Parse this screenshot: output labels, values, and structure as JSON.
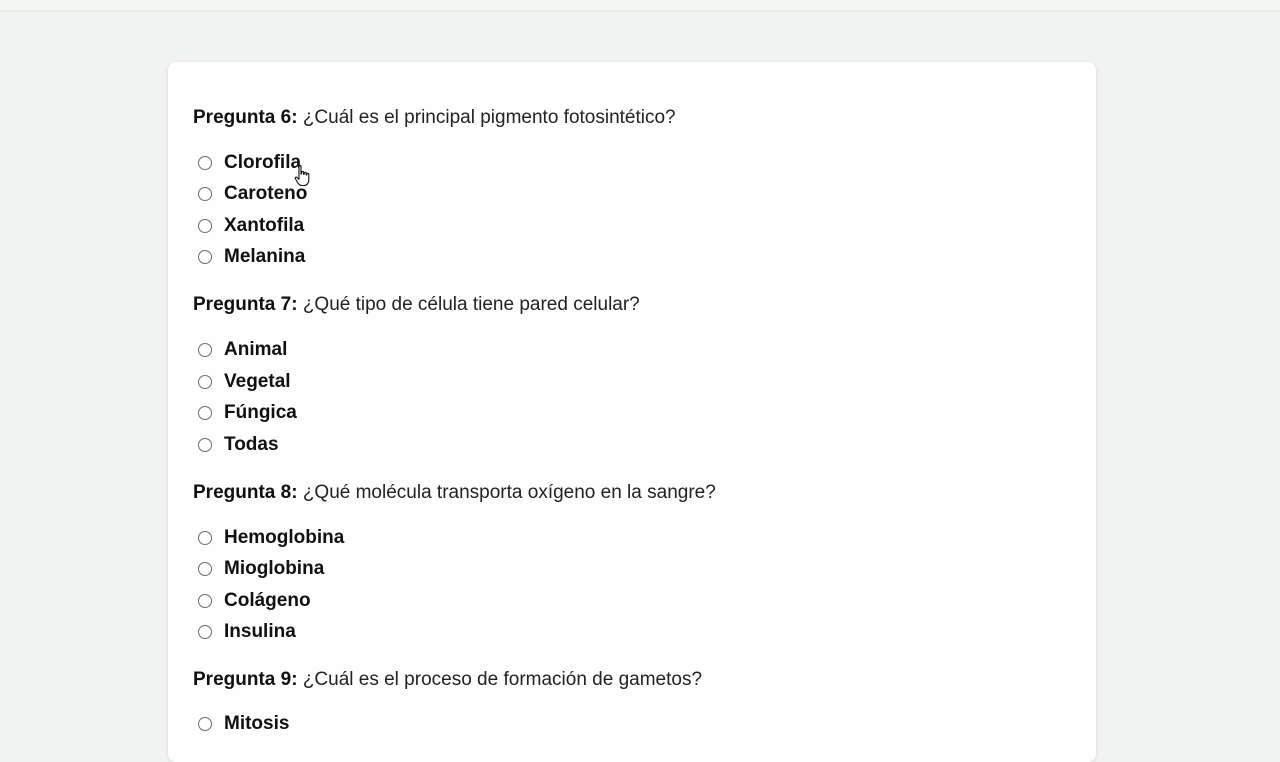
{
  "questions": [
    {
      "label": "Pregunta 6:",
      "text": "¿Cuál es el principal pigmento fotosintético?",
      "options": [
        "Clorofila",
        "Caroteno",
        "Xantofila",
        "Melanina"
      ]
    },
    {
      "label": "Pregunta 7:",
      "text": "¿Qué tipo de célula tiene pared celular?",
      "options": [
        "Animal",
        "Vegetal",
        "Fúngica",
        "Todas"
      ]
    },
    {
      "label": "Pregunta 8:",
      "text": "¿Qué molécula transporta oxígeno en la sangre?",
      "options": [
        "Hemoglobina",
        "Mioglobina",
        "Colágeno",
        "Insulina"
      ]
    },
    {
      "label": "Pregunta 9:",
      "text": "¿Cuál es el proceso de formación de gametos?",
      "options": [
        "Mitosis"
      ]
    }
  ],
  "icons": {
    "cursor": "hand-pointer-icon",
    "radio": "radio-unchecked-icon"
  },
  "colors": {
    "page_background": "#f0f3f2",
    "card_background": "#fefefe",
    "text": "#111111"
  }
}
